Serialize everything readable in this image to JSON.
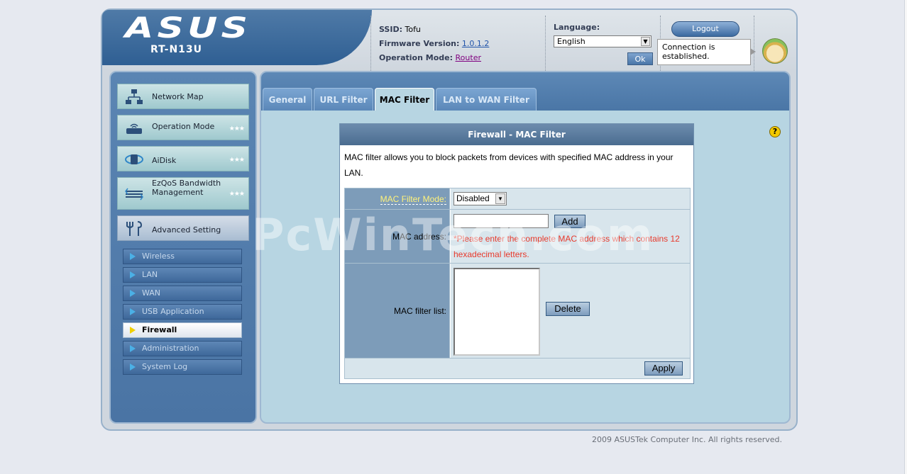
{
  "brand": {
    "logo": "ASUS",
    "model": "RT-N13U"
  },
  "status": {
    "ssid_label": "SSID:",
    "ssid_value": "Tofu",
    "firmware_label": "Firmware Version:",
    "firmware_value": "1.0.1.2",
    "opmode_label": "Operation Mode:",
    "opmode_value": "Router"
  },
  "language": {
    "label": "Language:",
    "selected": "English",
    "ok_label": "Ok"
  },
  "logout_label": "Logout",
  "connection_text": "Connection is established.",
  "sidebar": {
    "menu": [
      {
        "label": "Network Map",
        "icon": "network-map-icon",
        "stars": ""
      },
      {
        "label": "Operation Mode",
        "icon": "router-icon",
        "stars": "★★★"
      },
      {
        "label": "AiDisk",
        "icon": "disk-icon",
        "stars": "★★★"
      },
      {
        "label": "EzQoS Bandwidth Management",
        "icon": "bandwidth-icon",
        "stars": "★★★"
      },
      {
        "label": "Advanced Setting",
        "icon": "tools-icon",
        "stars": ""
      }
    ],
    "sub": [
      "Wireless",
      "LAN",
      "WAN",
      "USB Application",
      "Firewall",
      "Administration",
      "System Log"
    ],
    "active_sub": "Firewall"
  },
  "tabs": [
    "General",
    "URL Filter",
    "MAC Filter",
    "LAN to WAN Filter"
  ],
  "active_tab": "MAC Filter",
  "help_icon": "?",
  "panel": {
    "title": "Firewall - MAC Filter",
    "description": "MAC filter allows you to block packets from devices with specified MAC address in your LAN.",
    "mode_label": "MAC Filter Mode:",
    "mode_value": "Disabled",
    "mac_label": "MAC address:",
    "mac_value": "",
    "add_label": "Add",
    "warning": "*Please enter the complete MAC address which contains 12 hexadecimal letters.",
    "list_label": "MAC filter list:",
    "delete_label": "Delete",
    "apply_label": "Apply"
  },
  "watermark": "PcWinTech.com",
  "footer": "2009 ASUSTek Computer Inc. All rights reserved.",
  "colors": {
    "accent": "#4a76a6",
    "warning": "#e8392b",
    "mode_label": "#fff27a"
  }
}
